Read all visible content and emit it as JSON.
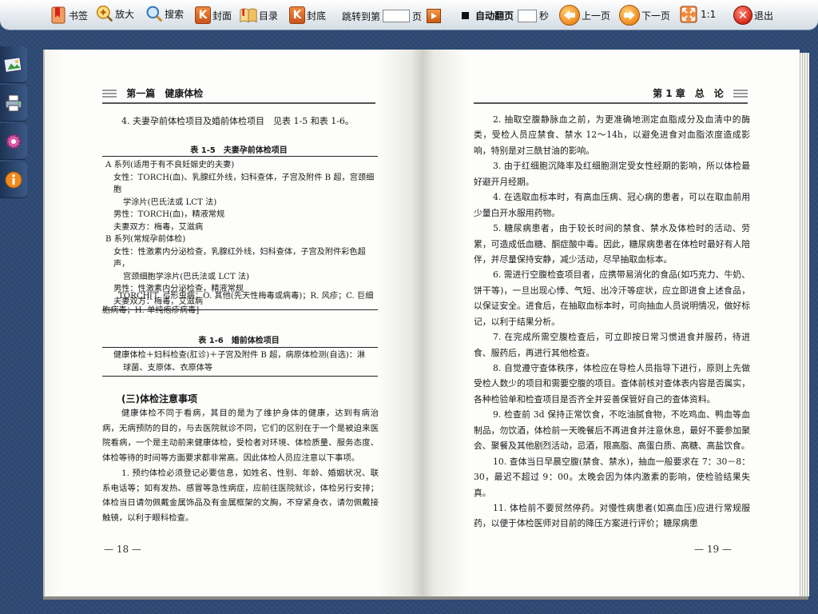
{
  "toolbar": {
    "bookmark": "书签",
    "zoom_in": "放大",
    "search": "搜索",
    "cover": "封面",
    "toc": "目录",
    "back_cover": "封底",
    "jump_to": "跳转到第",
    "jump_page_unit": "页",
    "auto_flip": "自动翻页",
    "auto_flip_unit": "秒",
    "prev_page": "上一页",
    "next_page": "下一页",
    "ratio": "1:1",
    "exit": "退出"
  },
  "left_page": {
    "running_head": "第一篇　健康体检",
    "intro_line": "4. 夫妻孕前体检项目及婚前体检项目　见表 1-5 和表 1-6。",
    "table1": {
      "caption": "表 1-5　夫妻孕前体检项目",
      "rows": [
        "A 系列(适用于有不良妊娠史的夫妻)",
        "女性：TORCH(血)、乳腺红外线，妇科查体，子宫及附件 B 超，宫颈细胞",
        "学涂片(巴氏法或 LCT 法)",
        "男性：TORCH(血)，精液常规",
        "夫妻双方：梅毒，艾滋病",
        "B 系列(常规孕前体检)",
        "女性：性激素内分泌检查，乳腺红外线，妇科查体，子宫及附件彩色超声，",
        "宫颈细胞学涂片(巴氏法或 LCT 法)",
        "男性：性激素内分泌检查，精液常规",
        "夫妻双方：梅毒，艾滋病"
      ],
      "note": "TORCH[T. 弓形虫病；O. 其他(先天性梅毒或病毒)；R. 风疹；C. 巨细胞病毒；H. 单纯疱疹病毒]"
    },
    "table2": {
      "caption": "表 1-6　婚前体检项目",
      "row1": "健康体检＋妇科检查(肛诊)＋子宫及附件 B 超，病原体检测(自选)：淋",
      "row2": "球菌、支原体、衣原体等"
    },
    "section_title": "(三)体检注意事项",
    "paragraphs": [
      "健康体检不同于看病，其目的是为了维护身体的健康，达到有病治病，无病预防的目的，与去医院就诊不同，它们的区别在于一个是被迫来医院看病，一个是主动前来健康体检，受检者对环境、体检质量、服务态度、体检等待的时间等方面要求都非常高。因此体检人员应注意以下事项。",
      "1. 预约体检必须登记必要信息，如姓名、性别、年龄、婚姻状况、联系电话等；如有发热、感冒等急性病症，应前往医院就诊，体检另行安排；体检当日请勿佩戴金属饰品及有金属框架的文胸，不穿紧身衣，请勿佩戴接触镜，以利于眼科检查。"
    ],
    "folio": "— 18 —"
  },
  "right_page": {
    "running_head": "第 1 章　总　论",
    "paragraphs": [
      "2. 抽取空腹静脉血之前，为更准确地测定血脂成分及血清中的酶类，受检人员应禁食、禁水 12～14h，以避免进食对血脂浓度造成影响，特别是对三酰甘油的影响。",
      "3. 由于红细胞沉降率及红细胞测定受女性经期的影响，所以体检最好避开月经期。",
      "4. 在选取血标本时，有高血压病、冠心病的患者，可以在取血前用少量白开水服用药物。",
      "5. 糖尿病患者，由于较长时间的禁食、禁水及体检时的活动、劳累，可造成低血糖、酮症酸中毒。因此，糖尿病患者在体检时最好有人陪伴，并尽量保持安静，减少活动，尽早抽取血标本。",
      "6. 需进行空腹检查项目者，应携带易消化的食品(如巧克力、牛奶、饼干等)，一旦出现心悸、气短、出冷汗等症状，应立即进食上述食品，以保证安全。进食后，在抽取血标本时，可向抽血人员说明情况，做好标记，以利于结果分析。",
      "7. 在完成所需空腹检查后，可立即按日常习惯进食并服药，待进食、服药后，再进行其他检查。",
      "8. 自觉遵守查体秩序，体检应在导检人员指导下进行，原则上先做受检人数少的项目和需要空腹的项目。查体前核对查体表内容是否属实，各种检验单和检查项目是否齐全并妥善保管好自己的查体资料。",
      "9. 检查前 3d 保持正常饮食，不吃油腻食物，不吃鸡血、鸭血等血制品，勿饮酒，体检前一天晚餐后不再进食并注意休息，最好不要参加聚会、聚餐及其他剧烈活动，忌酒，限高脂、高蛋白质、高糖、高盐饮食。",
      "10. 查体当日早晨空腹(禁食、禁水)，抽血一般要求在 7：30－8：30，最迟不超过 9：00。太晚会因为体内激素的影响，使检验结果失真。",
      "11. 体检前不要贸然停药。对慢性病患者(如高血压)应进行常规服药，以便于体检医师对目前的降压方案进行评价；糖尿病患"
    ],
    "folio": "— 19 —"
  }
}
